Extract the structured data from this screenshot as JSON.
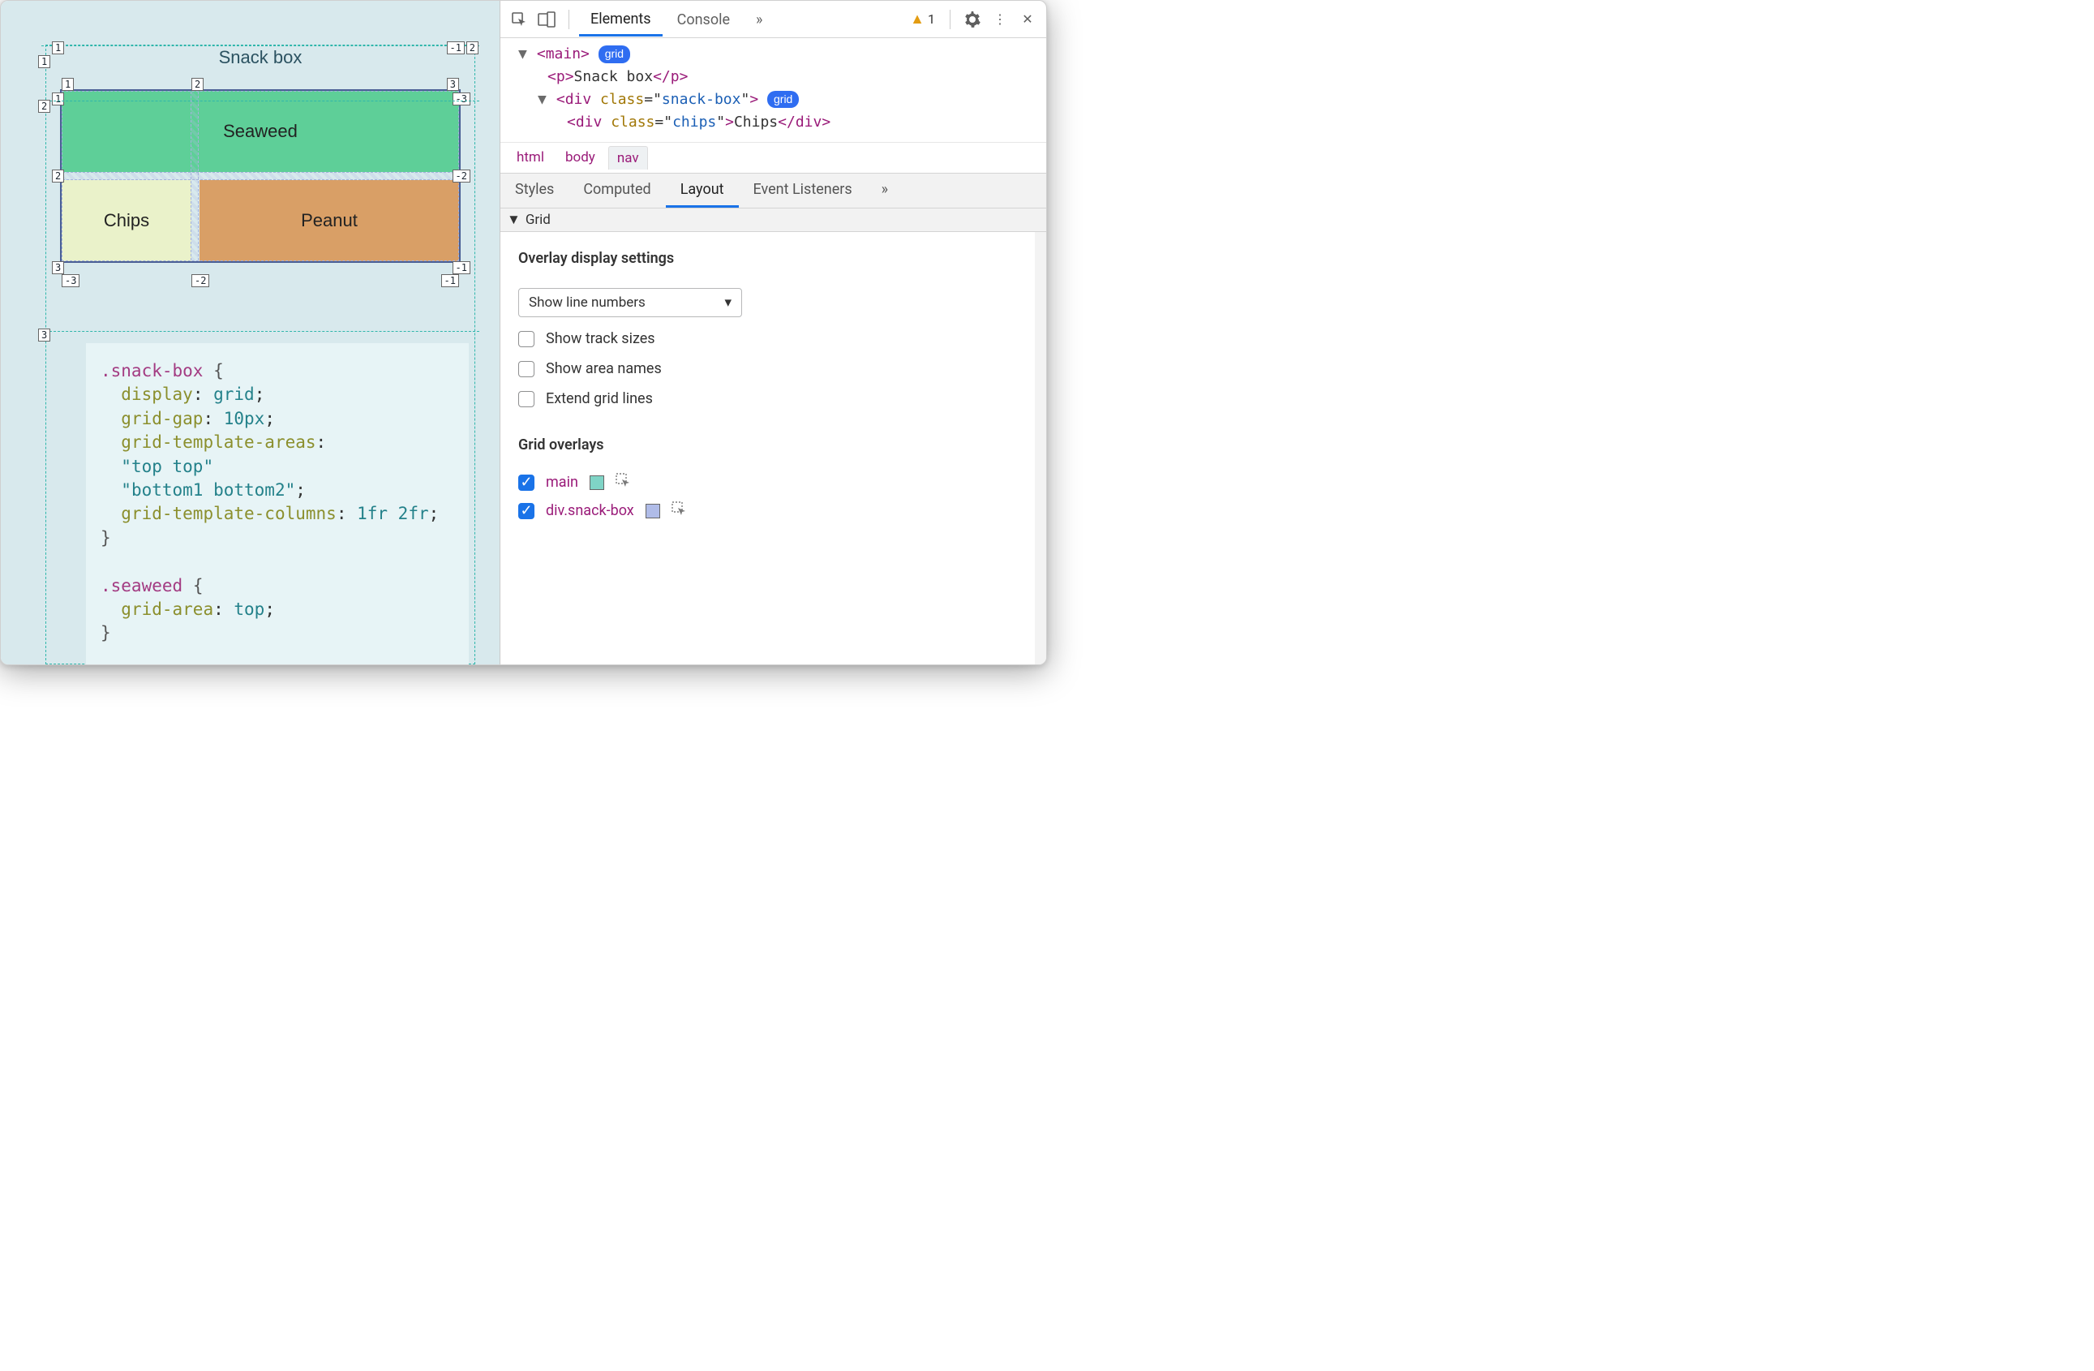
{
  "preview": {
    "title": "Snack box",
    "items": {
      "seaweed": "Seaweed",
      "chips": "Chips",
      "peanut": "Peanut"
    },
    "outer_labels": {
      "col_left": "1",
      "col_right": "-1",
      "c_right_pos": "2",
      "row_1": "1",
      "row_2": "2",
      "row_3": "3"
    },
    "inner_labels": {
      "cols_top": [
        "1",
        "2",
        "3"
      ],
      "cols_top_neg": [
        "-3",
        "-2",
        "-1"
      ],
      "rows_left": [
        "1",
        "2",
        "3"
      ],
      "rows_left_neg": [
        "-3",
        "-2",
        "-1"
      ],
      "cols_bot_neg": [
        "-3",
        "-2",
        "-1"
      ],
      "rows_right_neg": [
        "-3",
        "-2",
        "-1"
      ]
    },
    "code": ".snack-box {\n  display: grid;\n  grid-gap: 10px;\n  grid-template-areas:\n  \"top top\"\n  \"bottom1 bottom2\";\n  grid-template-columns: 1fr 2fr;\n}\n\n.seaweed {\n  grid-area: top;\n}"
  },
  "devtools": {
    "tabs": [
      "Elements",
      "Console"
    ],
    "active_tab": "Elements",
    "warning_count": "1",
    "dom": {
      "l1": {
        "caret": "▼",
        "open": "<",
        "name": "main",
        "close": ">",
        "badge": "grid"
      },
      "l2": {
        "open": "<",
        "name": "p",
        "mid": ">",
        "text": "Snack box",
        "close": "</p>"
      },
      "l3": {
        "caret": "▼",
        "open": "<",
        "name": "div",
        "attr": "class",
        "val": "snack-box",
        "close": ">",
        "badge": "grid"
      },
      "l4": {
        "open": "<",
        "name": "div",
        "attr": "class",
        "val": "chips",
        "mid": ">",
        "text": "Chips",
        "close": "</div>"
      }
    },
    "breadcrumb": [
      "html",
      "body",
      "nav"
    ],
    "subtabs": [
      "Styles",
      "Computed",
      "Layout",
      "Event Listeners"
    ],
    "active_subtab": "Layout",
    "grid_section_label": "Grid",
    "overlay_display": {
      "heading": "Overlay display settings",
      "select": "Show line numbers",
      "opts": [
        "Show track sizes",
        "Show area names",
        "Extend grid lines"
      ]
    },
    "grid_overlays": {
      "heading": "Grid overlays",
      "items": [
        {
          "label": "main",
          "swatch": "#7FD4C6",
          "checked": true
        },
        {
          "label": "div.snack-box",
          "swatch": "#B0BCE8",
          "checked": true
        }
      ]
    }
  }
}
